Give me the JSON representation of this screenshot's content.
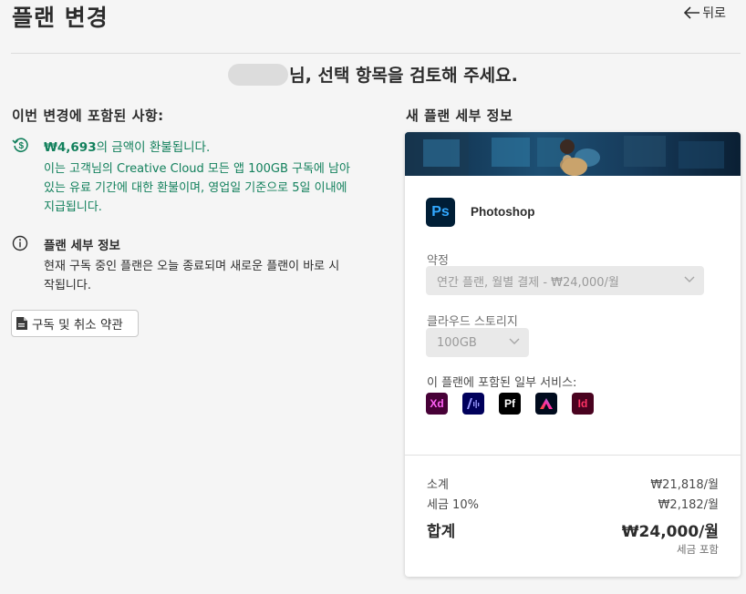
{
  "page": {
    "title": "플랜 변경",
    "back_label": "뒤로",
    "heading_suffix": "님, 선택 항목을 검토해 주세요."
  },
  "changes": {
    "title": "이번 변경에 포함된 사항:",
    "refund_amount": "₩4,693",
    "refund_suffix": "의 금액이 환불됩니다.",
    "refund_desc": "이는 고객님의 Creative Cloud 모든 앱 100GB 구독에 남아 있는 유료 기간에 대한 환불이며, 영업일 기준으로 5일 이내에 지급됩니다.",
    "info_title": "플랜 세부 정보",
    "info_desc": "현재 구독 중인 플랜은 오늘 종료되며 새로운 플랜이 바로 시작됩니다.",
    "terms_label": "구독 및 취소 약관"
  },
  "new_plan": {
    "title": "새 플랜 세부 정보",
    "product_icon_text": "Ps",
    "product_name": "Photoshop",
    "commitment_label": "약정",
    "commitment_value": "연간 플랜, 월별 결제 - ₩24,000/월",
    "storage_label": "클라우드 스토리지",
    "storage_value": "100GB",
    "services_label": "이 플랜에 포함된 일부 서비스:",
    "services": [
      {
        "name": "xd-icon",
        "text": "Xd",
        "bg": "#470137",
        "fg": "#ff61f6"
      },
      {
        "name": "premiere-rush-icon",
        "text": "",
        "bg": "#00005b",
        "fg": "#9999ff"
      },
      {
        "name": "portfolio-icon",
        "text": "Pf",
        "bg": "#000000",
        "fg": "#ffffff"
      },
      {
        "name": "fresco-icon",
        "text": "",
        "bg": "#000b1d",
        "fg": "#ff5a1f"
      },
      {
        "name": "indesign-icon",
        "text": "Id",
        "bg": "#49021f",
        "fg": "#ff3366"
      }
    ],
    "subtotal_label": "소계",
    "subtotal_value": "₩21,818/월",
    "tax_label": "세금 10%",
    "tax_value": "₩2,182/월",
    "total_label": "합계",
    "total_value": "₩24,000/월",
    "tax_included": "세금 포함"
  },
  "colors": {
    "accent_green": "#12805c",
    "photoshop_bg": "#001e36",
    "photoshop_fg": "#31a8ff"
  }
}
